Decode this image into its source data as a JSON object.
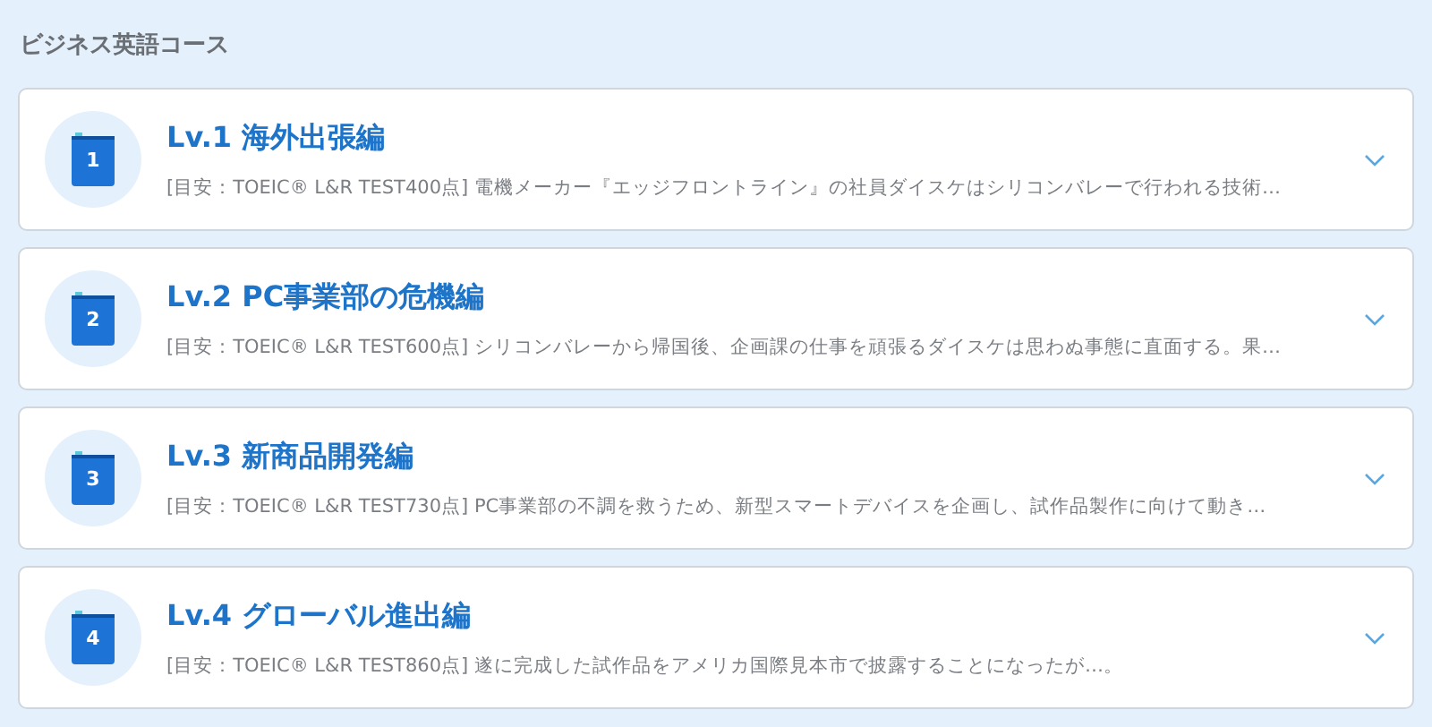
{
  "section_title": "ビジネス英語コース",
  "courses": [
    {
      "number": "1",
      "title": "Lv.1 海外出張編",
      "description": "[目安：TOEIC® L&R TEST400点] 電機メーカー『エッジフロントライン』の社員ダイスケはシリコンバレーで行われる技術…"
    },
    {
      "number": "2",
      "title": "Lv.2 PC事業部の危機編",
      "description": "[目安：TOEIC® L&R TEST600点] シリコンバレーから帰国後、企画課の仕事を頑張るダイスケは思わぬ事態に直面する。果…"
    },
    {
      "number": "3",
      "title": "Lv.3 新商品開発編",
      "description": "[目安：TOEIC® L&R TEST730点] PC事業部の不調を救うため、新型スマートデバイスを企画し、試作品製作に向けて動き…"
    },
    {
      "number": "4",
      "title": "Lv.4 グローバル進出編",
      "description": "[目安：TOEIC® L&R TEST860点] 遂に完成した試作品をアメリカ国際見本市で披露することになったが…。"
    }
  ]
}
